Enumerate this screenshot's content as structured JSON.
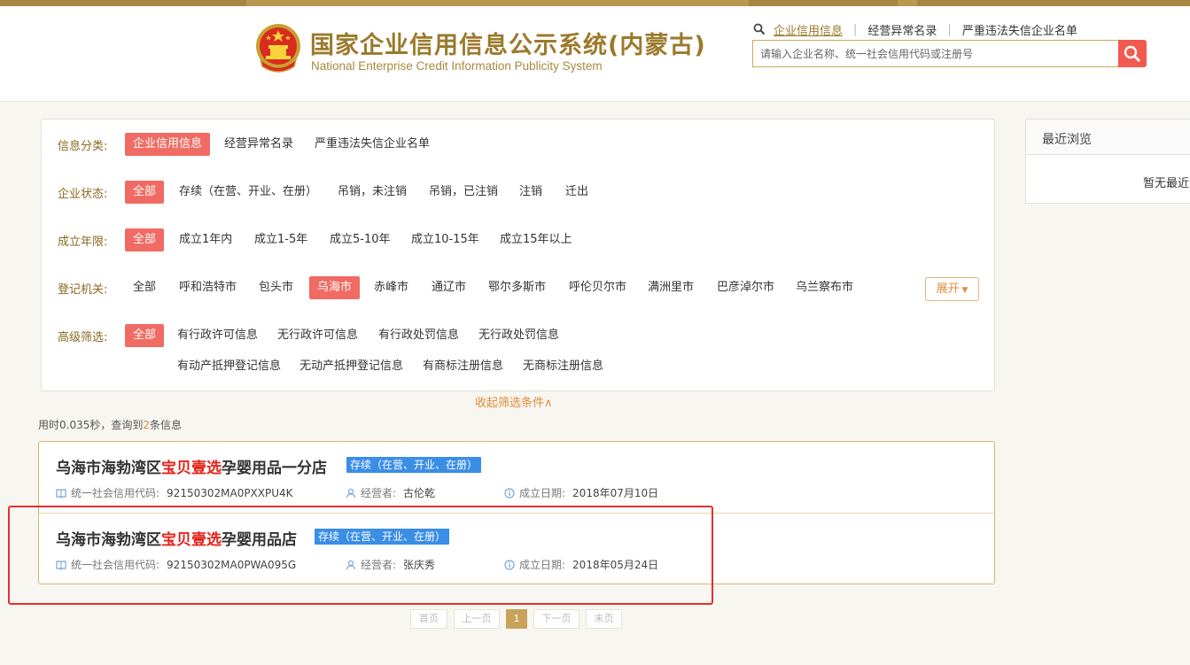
{
  "header": {
    "title": "国家企业信用信息公示系统(内蒙古)",
    "subtitle": "National Enterprise Credit Information Publicity System",
    "links": [
      "企业信用信息",
      "经营异常名录",
      "严重违法失信企业名单"
    ],
    "search_placeholder": "请输入企业名称、统一社会信用代码或注册号"
  },
  "filters": {
    "info_category": {
      "label": "信息分类:",
      "options": [
        "企业信用信息",
        "经营异常名录",
        "严重违法失信企业名单"
      ],
      "selected": "企业信用信息"
    },
    "status": {
      "label": "企业状态:",
      "options": [
        "全部",
        "存续（在营、开业、在册）",
        "吊销，未注销",
        "吊销，已注销",
        "注销",
        "迁出"
      ],
      "selected": "全部"
    },
    "age": {
      "label": "成立年限:",
      "options": [
        "全部",
        "成立1年内",
        "成立1-5年",
        "成立5-10年",
        "成立10-15年",
        "成立15年以上"
      ],
      "selected": "全部"
    },
    "authority": {
      "label": "登记机关:",
      "options": [
        "全部",
        "呼和浩特市",
        "包头市",
        "乌海市",
        "赤峰市",
        "通辽市",
        "鄂尔多斯市",
        "呼伦贝尔市",
        "满洲里市",
        "巴彦淖尔市",
        "乌兰察布市"
      ],
      "selected": "乌海市",
      "expand_label": "展开"
    },
    "advanced": {
      "label": "高级筛选:",
      "options_row1": [
        "全部",
        "有行政许可信息",
        "无行政许可信息",
        "有行政处罚信息",
        "无行政处罚信息"
      ],
      "options_row2": [
        "有动产抵押登记信息",
        "无动产抵押登记信息",
        "有商标注册信息",
        "无商标注册信息"
      ],
      "selected": "全部"
    },
    "collapse_label": "收起筛选条件∧"
  },
  "stats": {
    "prefix": "用时",
    "time": "0.035",
    "mid": "秒，查询到",
    "count": "2",
    "suffix": "条信息"
  },
  "results": [
    {
      "name_prefix": "乌海市海勃湾区",
      "name_highlight": "宝贝壹选",
      "name_suffix": "孕婴用品一分店",
      "status": "存续（在营、开业、在册）",
      "code_label": "统一社会信用代码:",
      "code": "92150302MA0PXXPU4K",
      "operator_label": "经营者:",
      "operator": "古伦乾",
      "date_label": "成立日期:",
      "date": "2018年07月10日"
    },
    {
      "name_prefix": "乌海市海勃湾区",
      "name_highlight": "宝贝壹选",
      "name_suffix": "孕婴用品店",
      "status": "存续（在营、开业、在册）",
      "code_label": "统一社会信用代码:",
      "code": "92150302MA0PWA095G",
      "operator_label": "经营者:",
      "operator": "张庆秀",
      "date_label": "成立日期:",
      "date": "2018年05月24日"
    }
  ],
  "pagination": {
    "first": "首页",
    "prev": "上一页",
    "current": "1",
    "next": "下一页",
    "last": "末页"
  },
  "recent": {
    "title": "最近浏览",
    "empty": "暂无最近浏览"
  },
  "colors": {
    "gold": "#9b7a2c",
    "accent_red": "#f06b63",
    "highlight_red": "#e3231a",
    "status_blue": "#3a8ee6"
  }
}
